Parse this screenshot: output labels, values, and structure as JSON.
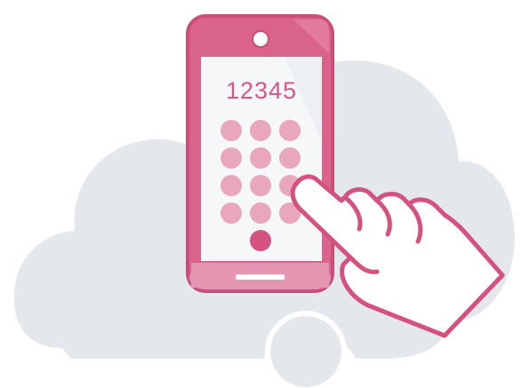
{
  "display": {
    "number": "12345"
  },
  "colors": {
    "background": "#ffffff",
    "cloud": "#e4e8ec",
    "phone_body": "#d9638b",
    "phone_outline": "#c94e79",
    "phone_chin": "#e495b2",
    "screen": "#f6f7f9",
    "keypad_dot": "#e8a7bb",
    "call_button": "#d4527f",
    "number_text": "#d5578a",
    "hand_fill": "#ffffff",
    "hand_outline": "#d4527f"
  },
  "icons": {
    "cloud": "cloud-icon",
    "phone": "smartphone-icon",
    "hand": "pointing-hand-icon"
  }
}
